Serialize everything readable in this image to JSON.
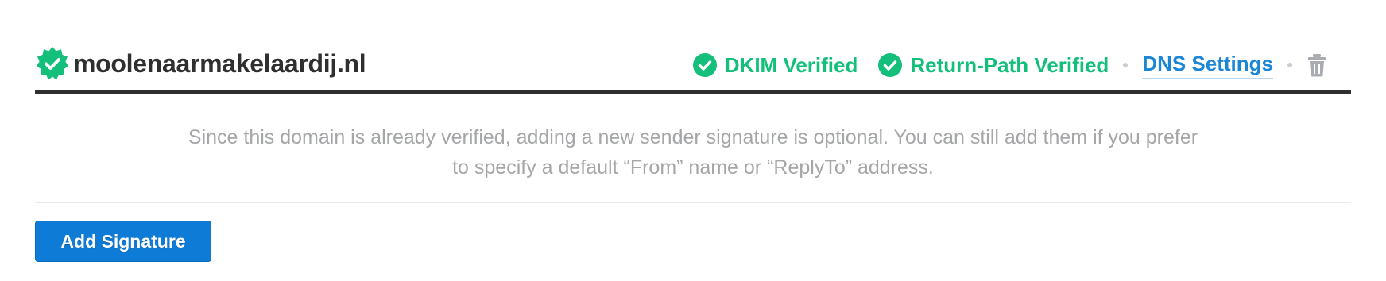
{
  "domain": {
    "name": "moolenaarmakelaardij.nl",
    "badge_icon": "verified-seal-icon",
    "badge_color": "#13bf7a"
  },
  "statuses": [
    {
      "label": "DKIM Verified",
      "icon": "check-circle-icon",
      "color": "#13bf7a"
    },
    {
      "label": "Return-Path Verified",
      "icon": "check-circle-icon",
      "color": "#13bf7a"
    }
  ],
  "links": {
    "dns_settings": "DNS Settings",
    "link_color": "#1c86d6"
  },
  "actions": {
    "delete_icon": "trash-icon"
  },
  "notice": {
    "line1": "Since this domain is already verified, adding a new sender signature is optional. You can still add them if you prefer",
    "line2": "to specify a default “From” name or “ReplyTo” address."
  },
  "buttons": {
    "add_signature": "Add Signature",
    "primary_color": "#0e7cd6"
  }
}
